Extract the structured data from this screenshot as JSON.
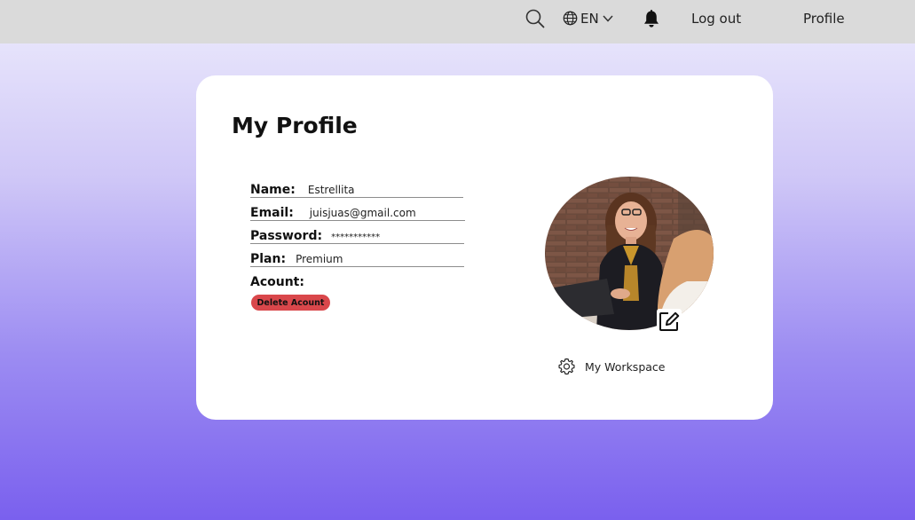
{
  "topbar": {
    "language": "EN",
    "logout_label": "Log out",
    "profile_label": "Profile"
  },
  "page": {
    "title": "My Profile"
  },
  "profile": {
    "name_label": "Name:",
    "name_value": "Estrellita",
    "email_label": "Email:",
    "email_value": "juisjuas@gmail.com",
    "password_label": "Password:",
    "password_value": "***********",
    "plan_label": "Plan:",
    "plan_value": "Premium",
    "account_label": "Acount:",
    "delete_label": "Delete Acount"
  },
  "workspace_label": "My Workspace",
  "icons": [
    "search-icon",
    "globe-icon",
    "chevron-down-icon",
    "bell-icon",
    "edit-icon",
    "gear-icon"
  ],
  "colors": {
    "topbar": "#dadada",
    "gradient_top": "#e6e3fb",
    "gradient_bottom": "#7a60ee",
    "delete_button": "#d9474b"
  }
}
